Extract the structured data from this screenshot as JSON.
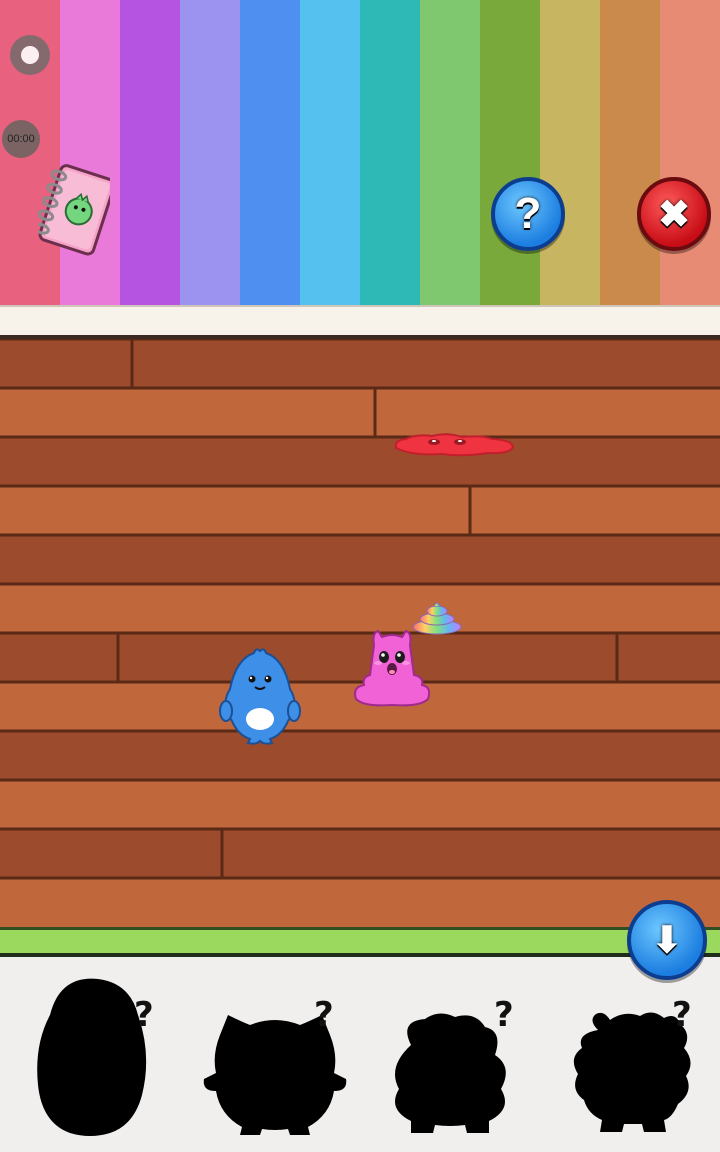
{
  "wall": {
    "stripes": [
      "#e8617f",
      "#e97ad9",
      "#b454e0",
      "#9b93ef",
      "#4f8ff0",
      "#55c1ef",
      "#2fb9b6",
      "#7fc870",
      "#79a93b",
      "#c8b561",
      "#c98a4c",
      "#e88b75"
    ]
  },
  "hud": {
    "timer": "00:00",
    "help_glyph": "?",
    "close_glyph": "✖",
    "down_glyph": "⬇"
  },
  "icons": {
    "record": "record-icon",
    "journal": "journal-book-icon",
    "help": "question-mark-icon",
    "close": "close-x-icon",
    "down": "arrow-down-icon"
  },
  "colors": {
    "floor_light": "#c0673c",
    "floor_dark": "#9c4c2c",
    "blue_pet": "#3d8fe8",
    "pink_pet": "#f062d6",
    "red_slime": "#ef3340",
    "green_strip": "#9ad85e"
  },
  "collection": {
    "slots": [
      {
        "label": "?"
      },
      {
        "label": "?"
      },
      {
        "label": "?"
      },
      {
        "label": "?"
      }
    ]
  }
}
